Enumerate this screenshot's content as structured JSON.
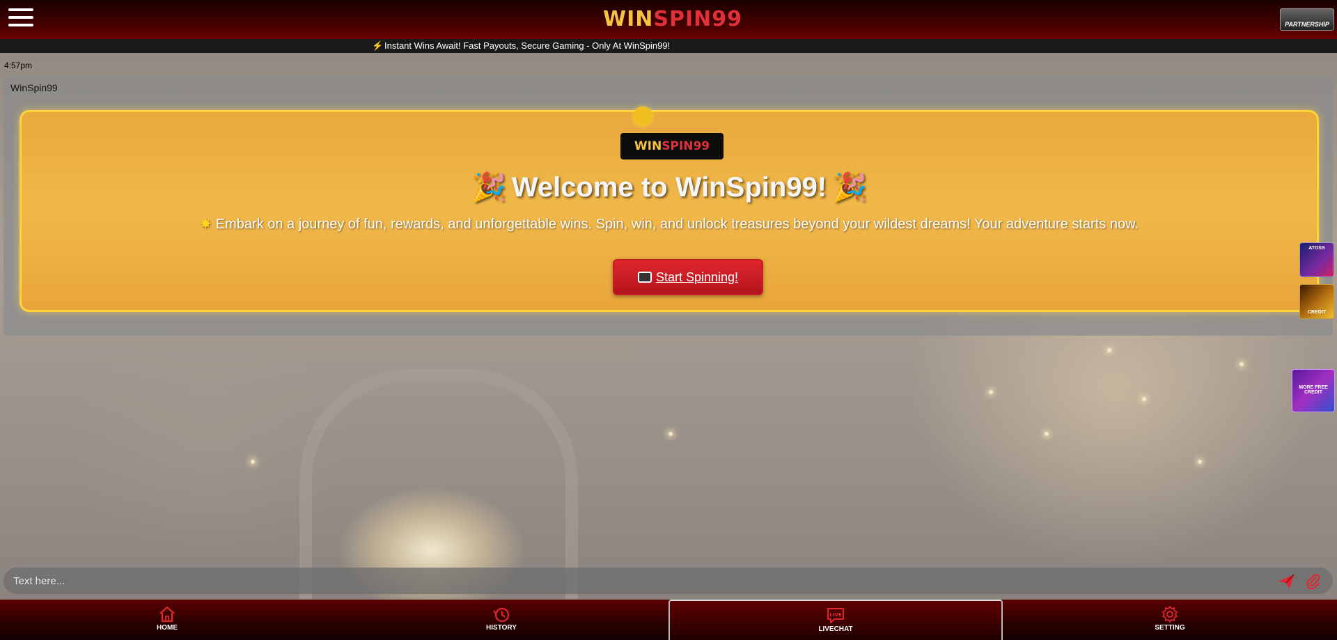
{
  "header": {
    "logo_win": "WIN",
    "logo_spin": "SPIN99",
    "partnership_label": "PARTNERSHIP"
  },
  "ticker": {
    "text": "Instant Wins Await! Fast Payouts, Secure Gaming - Only At WinSpin99!"
  },
  "chat": {
    "time": "4:57pm",
    "sender": "WinSpin99",
    "banner": {
      "logo_win": "WIN",
      "logo_spin": "SPIN99",
      "title": "Welcome to WinSpin99!",
      "subtitle": "Embark on a journey of fun, rewards, and unforgettable wins. Spin, win, and unlock treasures beyond your wildest dreams! Your adventure starts now.",
      "button_label": "Start Spinning!"
    }
  },
  "side_thumbs": [
    {
      "label": "ATOSS"
    },
    {
      "label": "CREDIT"
    },
    {
      "label": "MORE FREE CREDIT"
    }
  ],
  "input": {
    "placeholder": "Text here..."
  },
  "bottom_nav": {
    "items": [
      {
        "label": "HOME",
        "icon": "home-icon"
      },
      {
        "label": "HISTORY",
        "icon": "history-icon"
      },
      {
        "label": "LIVECHAT",
        "icon": "livechat-icon",
        "active": true
      },
      {
        "label": "SETTING",
        "icon": "gear-icon"
      }
    ]
  },
  "colors": {
    "header_red": "#4a0000",
    "banner_gold": "#f0b84a",
    "button_red": "#e0262f",
    "logo_gold": "#f5c242"
  }
}
